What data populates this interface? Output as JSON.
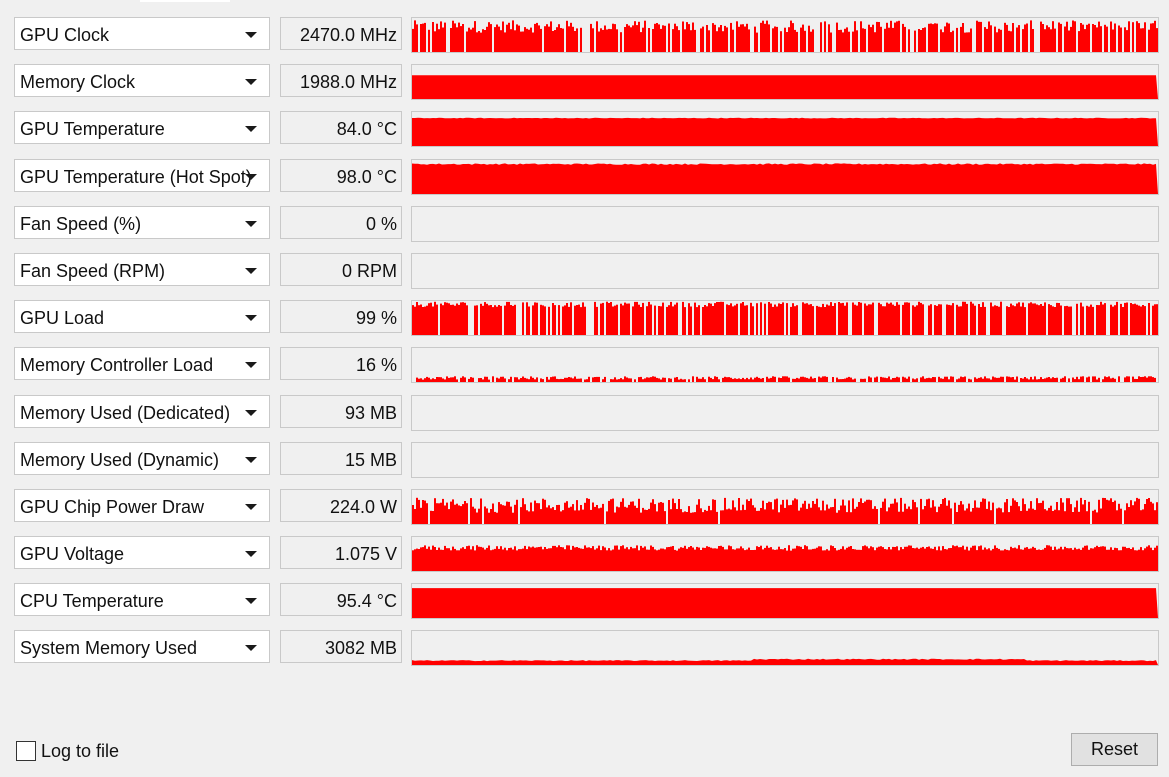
{
  "colors": {
    "graph_fill": "#ff0000",
    "background": "#f0f0f0"
  },
  "sensors": [
    {
      "name": "GPU Clock",
      "value": "2470.0 MHz",
      "graph": {
        "pattern": "bars",
        "level": 0.75,
        "variation": 0.18,
        "gap": 0.22
      }
    },
    {
      "name": "Memory Clock",
      "value": "1988.0 MHz",
      "graph": {
        "pattern": "solid",
        "level": 0.7,
        "variation": 0.0,
        "gap": 0.0
      }
    },
    {
      "name": "GPU Temperature",
      "value": "84.0 °C",
      "graph": {
        "pattern": "solid",
        "level": 0.82,
        "variation": 0.02,
        "gap": 0.0
      }
    },
    {
      "name": "GPU Temperature (Hot Spot)",
      "value": "98.0 °C",
      "graph": {
        "pattern": "solid",
        "level": 0.88,
        "variation": 0.04,
        "gap": 0.0
      }
    },
    {
      "name": "Fan Speed (%)",
      "value": "0 %",
      "graph": {
        "pattern": "none",
        "level": 0.0,
        "variation": 0.0,
        "gap": 0.0
      }
    },
    {
      "name": "Fan Speed (RPM)",
      "value": "0 RPM",
      "graph": {
        "pattern": "none",
        "level": 0.0,
        "variation": 0.0,
        "gap": 0.0
      }
    },
    {
      "name": "GPU Load",
      "value": "99 %",
      "graph": {
        "pattern": "bars",
        "level": 0.9,
        "variation": 0.08,
        "gap": 0.22
      }
    },
    {
      "name": "Memory Controller Load",
      "value": "16 %",
      "graph": {
        "pattern": "bars",
        "level": 0.12,
        "variation": 0.05,
        "gap": 0.15
      }
    },
    {
      "name": "Memory Used (Dedicated)",
      "value": "93 MB",
      "graph": {
        "pattern": "none",
        "level": 0.0,
        "variation": 0.0,
        "gap": 0.0
      }
    },
    {
      "name": "Memory Used (Dynamic)",
      "value": "15 MB",
      "graph": {
        "pattern": "none",
        "level": 0.0,
        "variation": 0.0,
        "gap": 0.0
      }
    },
    {
      "name": "GPU Chip Power Draw",
      "value": "224.0 W",
      "graph": {
        "pattern": "bars",
        "level": 0.55,
        "variation": 0.22,
        "gap": 0.05
      }
    },
    {
      "name": "GPU Voltage",
      "value": "1.075 V",
      "graph": {
        "pattern": "bars",
        "level": 0.68,
        "variation": 0.08,
        "gap": 0.0
      }
    },
    {
      "name": "CPU Temperature",
      "value": "95.4 °C",
      "graph": {
        "pattern": "solid",
        "level": 0.88,
        "variation": 0.0,
        "gap": 0.0
      }
    },
    {
      "name": "System Memory Used",
      "value": "3082 MB",
      "graph": {
        "pattern": "step",
        "level": 0.13,
        "variation": 0.03,
        "gap": 0.0
      }
    }
  ],
  "footer": {
    "log_label": "Log to file",
    "reset_label": "Reset"
  }
}
